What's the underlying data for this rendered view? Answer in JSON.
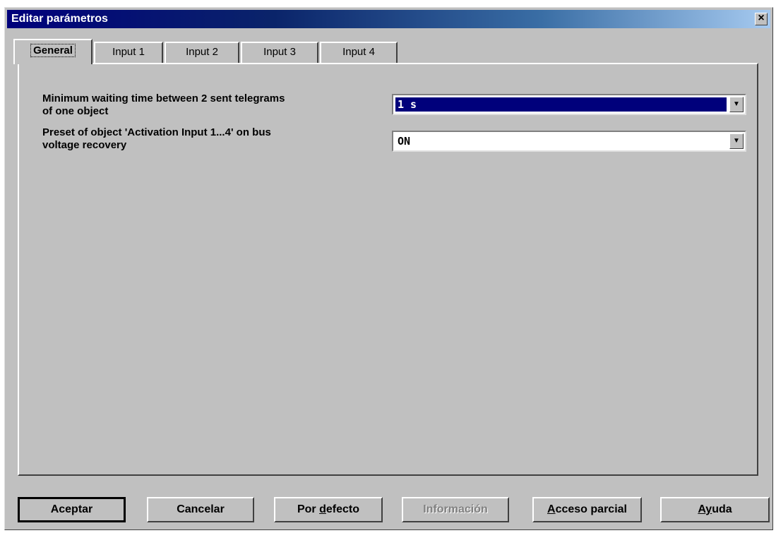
{
  "window": {
    "title": "Editar parámetros",
    "close_glyph": "×"
  },
  "tabs": [
    {
      "label": "General",
      "active": true
    },
    {
      "label": "Input 1"
    },
    {
      "label": "Input 2"
    },
    {
      "label": "Input 3"
    },
    {
      "label": "Input 4"
    }
  ],
  "params": [
    {
      "label_line1": "Minimum waiting time between 2 sent telegrams",
      "label_line2": "of one object",
      "value": "1 s"
    },
    {
      "label_line1": "Preset of object 'Activation Input 1...4' on bus",
      "label_line2": "voltage recovery",
      "value": "ON"
    }
  ],
  "buttons": {
    "accept": "Aceptar",
    "cancel": "Cancelar",
    "default_prefix": "Por ",
    "default_underlined": "d",
    "default_suffix": "efecto",
    "info": "Información",
    "partial_underlined": "A",
    "partial_suffix": "cceso parcial",
    "help_underlined": "A",
    "help_mid": "y",
    "help_suffix": "uda"
  },
  "icons": {
    "dropdown": "dropdown-arrow-icon",
    "close": "close-icon"
  }
}
